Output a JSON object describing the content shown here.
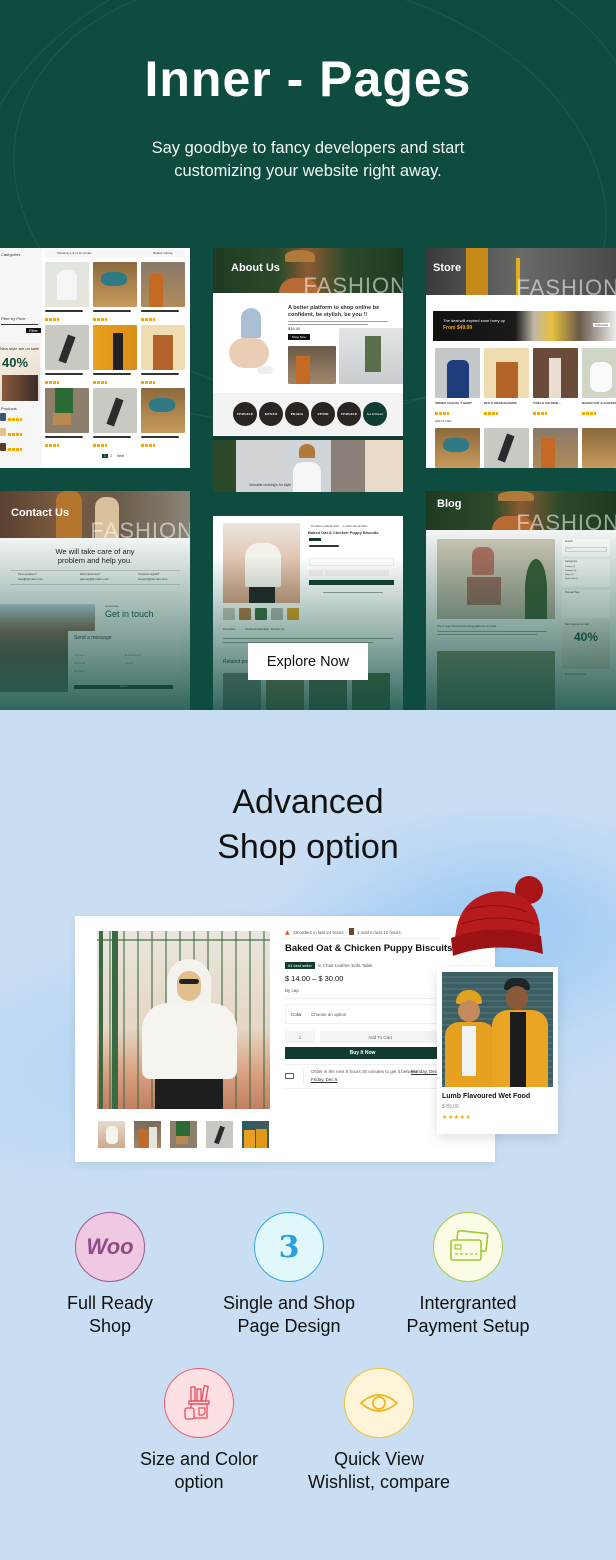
{
  "top_section": {
    "title": "Inner - Pages",
    "subtitle_line1": "Say goodbye to fancy developers and start",
    "subtitle_line2": "customizing your website right away.",
    "background_color": "#0f4c40",
    "explore_button": "Explore Now"
  },
  "previews": {
    "shop": {
      "sidebar_title": "Categories",
      "filter_title": "Filter by Price",
      "filter_button": "Filter",
      "promo_text": "New style are on sale!",
      "promo_discount": "40%",
      "promo_off": "OFF",
      "products_title": "Products",
      "sidebar_products": [
        "Unisex casual t-shirt",
        "Multi Grain Blends",
        "Ranch Flavour Flavoured Food"
      ],
      "toolbar_text": "Showing 1–9 of 12 results",
      "sort_text": "Default sorting",
      "products": [
        {
          "name": "Baked Oat & Chicken Puppy Biscuits"
        },
        {
          "name": "Cat Food Has Fish Dry"
        },
        {
          "name": "Chicken Flavoured Chunks"
        },
        {
          "name": "Lamb Flavoured Dry Food"
        },
        {
          "name": "Lumb Flavoured Wet Food"
        },
        {
          "name": "Multi Grain Blends"
        },
        {
          "name": "Parrot's Choice Millet Seeds"
        },
        {
          "name": "Salmon & Tuna Flavoured Food"
        },
        {
          "name": "Sea Fish Dry Cat Food"
        }
      ],
      "pagination": [
        "1",
        "2",
        "Next"
      ]
    },
    "about": {
      "hero_label": "About Us",
      "hero_word": "FASHION",
      "heading": "A better platform to shop online be confident, be stylish, be you !!",
      "price": "$16.40",
      "button": "Shop Now",
      "brands": [
        "VERSACE",
        "KENZO",
        "PRADA",
        "FENDI",
        "VERSACE",
        "See All Brands"
      ],
      "banner_text": "Versatile clothing's for style"
    },
    "store": {
      "hero_label": "Store",
      "hero_word": "FASHION",
      "deal_text": "The deal will expired soon hurry up",
      "deal_price": "From $49.99",
      "deal_button": "Subscribe",
      "products": [
        {
          "name": "UNISEX CASUAL T-SHIRT"
        },
        {
          "name": "MULTI GRAIN BLENDS"
        },
        {
          "name": "TUNA & SALMON..."
        },
        {
          "name": "BAKED OAT & CHICKEN"
        }
      ],
      "add_to_cart": "ADD TO CART"
    },
    "contact": {
      "hero_label": "Contact Us",
      "hero_word": "FASHION",
      "heading_line1": "We will take care of any",
      "heading_line2": "problem and help you.",
      "info": [
        {
          "label": "Have questions?",
          "value": "help@domain.com"
        },
        {
          "label": "Want partnership?",
          "value": "partner@domain.com"
        },
        {
          "label": "Customer support?",
          "value": "support@domain.com"
        }
      ],
      "get_in_touch_kicker": "Let us know",
      "get_in_touch": "Get in touch",
      "send_message": "Send a message",
      "fields": [
        "Full Name",
        "Email Address",
        "Phone No",
        "Subject",
        "Message"
      ],
      "submit": "Submit"
    },
    "product": {
      "orders_text": "19 orders in last 24 hours",
      "sold_text": "1 sold in last 12 hours",
      "name": "Baked Oat & Chicken Puppy Biscuits",
      "tabs": [
        "Description",
        "Additional Information",
        "Reviews (1)"
      ],
      "related_title": "Related products"
    },
    "blog": {
      "hero_label": "Blog",
      "hero_word": "FASHION",
      "post_title": "Top 9 dog food and feeding patterns to know",
      "search_title": "Search",
      "search_placeholder": "Search",
      "categories_title": "Categories",
      "categories": [
        "Fashion (3)",
        "Footwear (3)",
        "Shoes (1)",
        "Shoes Feel (2)"
      ],
      "tags_title": "Popular Tags",
      "promo_text": "New style are on sale!",
      "promo_discount": "40%",
      "product_categories_title": "Product Categories"
    }
  },
  "bottom_section": {
    "title_line1": "Advanced",
    "title_line2": "Shop option",
    "background_color": "#c9def3",
    "product_card": {
      "orders_text": "19 orders in last 24 hours",
      "sold_text": "1 sold in last 12 hours",
      "name": "Baked Oat & Chicken Puppy Biscuits",
      "badge": "#1 best seller",
      "badge_context": "in Chair Leather Sofa Table",
      "price": "$ 14.00 – $ 30.00",
      "by": "By cap",
      "color_label": "Color",
      "color_placeholder": "Choose an option",
      "quantity": "1",
      "add_to_cart": "Add To Cart",
      "buy_now": "Buy It Now",
      "delivery_text": "Order in the next 8 hours 30 minutes to get it between",
      "delivery_date1": "Monday, Dec 1",
      "delivery_date2": "Friday, Dec 5",
      "accent_color": "#123c33"
    },
    "related_card": {
      "name": "Lumb Flavoured Wet Food",
      "price": "$ 89.00",
      "rating": 5,
      "stars": "★★★★★"
    },
    "features": [
      {
        "icon": "woo-icon",
        "icon_text": "Woo",
        "line1": "Full Ready",
        "line2": "Shop",
        "circle_color": "#efc8e2",
        "border_color": "#9a5b8e"
      },
      {
        "icon": "number-3-icon",
        "icon_text": "3",
        "line1": "Single and Shop",
        "line2": "Page Design",
        "circle_color": "#e1f8fb",
        "border_color": "#35a7e0"
      },
      {
        "icon": "credit-card-icon",
        "icon_text": "",
        "line1": "Intergranted",
        "line2": "Payment Setup",
        "circle_color": "#fbfbe6",
        "border_color": "#a5cc3d"
      },
      {
        "icon": "pencil-cup-icon",
        "icon_text": "",
        "line1": "Size and Color",
        "line2": "option",
        "circle_color": "#fde0e3",
        "border_color": "#ef5d6d"
      },
      {
        "icon": "eye-icon",
        "icon_text": "",
        "line1": "Quick View",
        "line2": "Wishlist, compare",
        "circle_color": "#fdf4d9",
        "border_color": "#f2c232"
      }
    ]
  }
}
